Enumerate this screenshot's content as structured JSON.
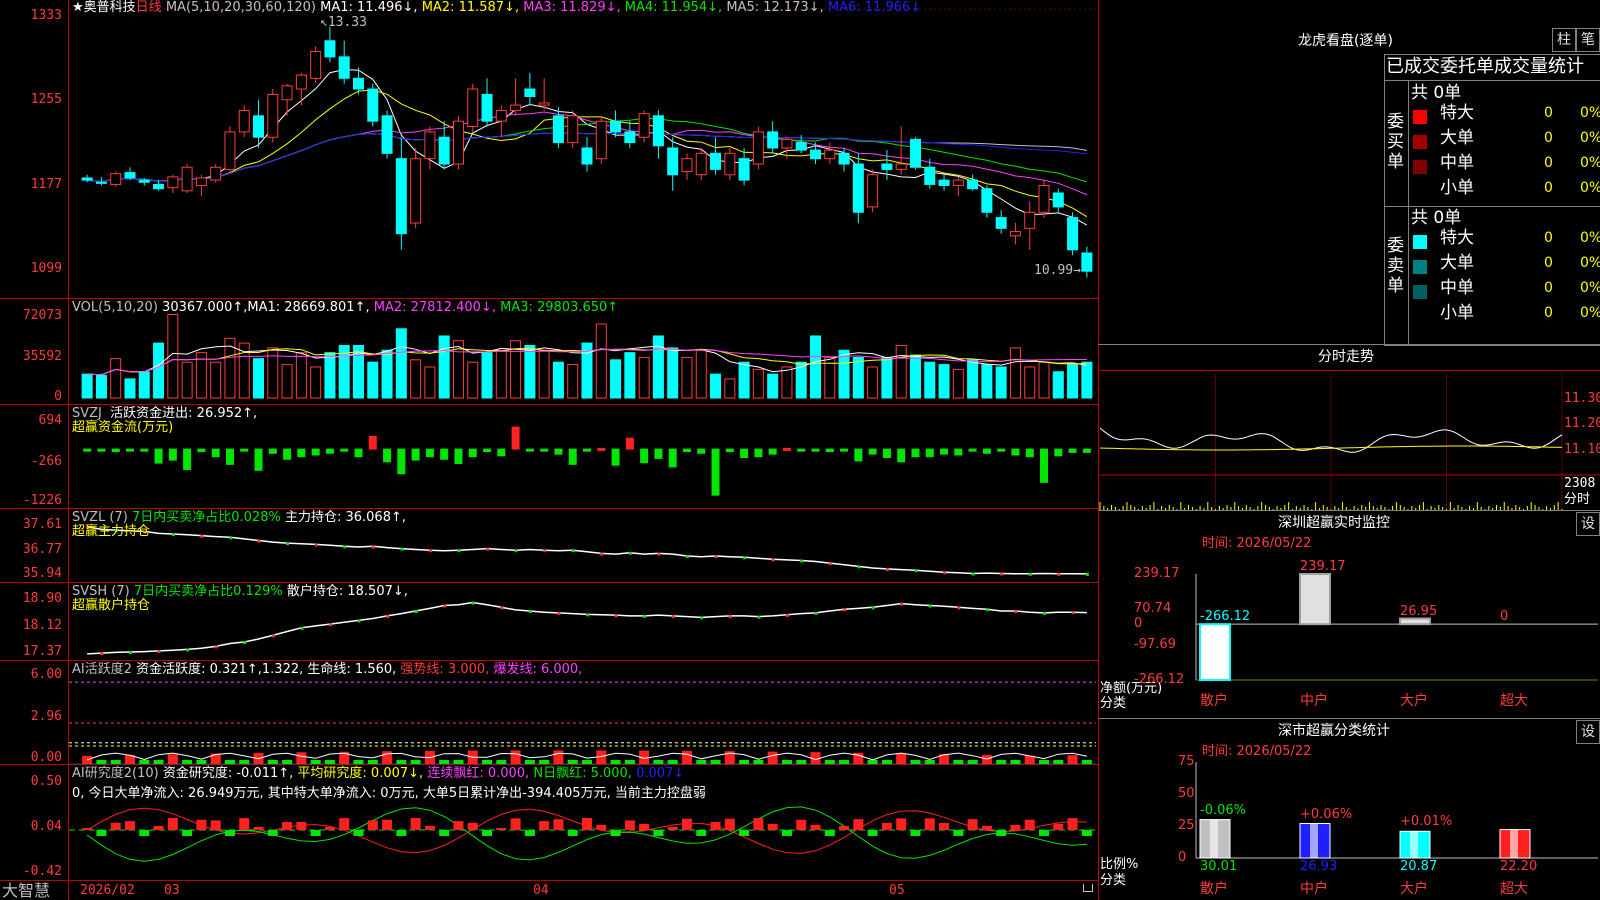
{
  "stock": {
    "star": "★",
    "name": "奥普科技",
    "period": "日线"
  },
  "main_chart": {
    "ma_header": "MA(5,10,20,30,60,120)",
    "ma1": "MA1: 11.496↓,",
    "ma2": "MA2: 11.587↓,",
    "ma3": "MA3: 11.829↓,",
    "ma4": "MA4: 11.954↓,",
    "ma5": "MA5: 12.173↓,",
    "ma6": "MA6: 11.966↓",
    "high_label": "13.33",
    "low_label": "10.99",
    "y_ticks": [
      "1333",
      "1255",
      "1177",
      "1099"
    ],
    "colors": {
      "ma1": "#ffffff",
      "ma2": "#ffff00",
      "ma3": "#ff40ff",
      "ma4": "#00e600",
      "ma5": "#c0c0c0",
      "ma6": "#2020ff",
      "up": "#ff3c3c",
      "down": "#00ffff"
    },
    "candles": [
      [
        11.92,
        11.95,
        11.88,
        11.9
      ],
      [
        11.88,
        11.93,
        11.85,
        11.87
      ],
      [
        11.86,
        11.98,
        11.84,
        11.96
      ],
      [
        11.97,
        12.02,
        11.9,
        11.92
      ],
      [
        11.9,
        11.92,
        11.85,
        11.88
      ],
      [
        11.86,
        11.9,
        11.8,
        11.82
      ],
      [
        11.83,
        11.95,
        11.78,
        11.93
      ],
      [
        11.8,
        12.05,
        11.78,
        12.02
      ],
      [
        11.85,
        11.95,
        11.75,
        11.92
      ],
      [
        11.9,
        12.05,
        11.88,
        12.02
      ],
      [
        12.0,
        12.4,
        11.98,
        12.35
      ],
      [
        12.35,
        12.6,
        12.3,
        12.55
      ],
      [
        12.5,
        12.65,
        12.2,
        12.3
      ],
      [
        12.3,
        12.75,
        12.25,
        12.7
      ],
      [
        12.65,
        12.8,
        12.5,
        12.78
      ],
      [
        12.75,
        12.9,
        12.6,
        12.88
      ],
      [
        12.85,
        13.15,
        12.8,
        13.1
      ],
      [
        13.2,
        13.33,
        13.0,
        13.05
      ],
      [
        13.05,
        13.2,
        12.8,
        12.85
      ],
      [
        12.85,
        12.95,
        12.7,
        12.75
      ],
      [
        12.75,
        12.8,
        12.4,
        12.45
      ],
      [
        12.5,
        12.55,
        12.1,
        12.15
      ],
      [
        12.1,
        12.3,
        11.25,
        11.4
      ],
      [
        11.5,
        12.2,
        11.45,
        12.1
      ],
      [
        12.1,
        12.4,
        12.0,
        12.35
      ],
      [
        12.3,
        12.45,
        12.0,
        12.05
      ],
      [
        12.05,
        12.5,
        12.0,
        12.45
      ],
      [
        12.4,
        12.8,
        12.35,
        12.75
      ],
      [
        12.7,
        12.85,
        12.4,
        12.45
      ],
      [
        12.45,
        12.6,
        12.3,
        12.55
      ],
      [
        12.55,
        12.85,
        12.5,
        12.6
      ],
      [
        12.75,
        12.9,
        12.6,
        12.68
      ],
      [
        12.6,
        12.85,
        12.55,
        12.62
      ],
      [
        12.5,
        12.58,
        12.2,
        12.25
      ],
      [
        12.25,
        12.55,
        12.2,
        12.5
      ],
      [
        12.2,
        12.3,
        11.98,
        12.05
      ],
      [
        12.1,
        12.5,
        12.05,
        12.45
      ],
      [
        12.45,
        12.55,
        12.3,
        12.35
      ],
      [
        12.35,
        12.45,
        12.2,
        12.25
      ],
      [
        12.3,
        12.55,
        12.25,
        12.52
      ],
      [
        12.5,
        12.55,
        12.1,
        12.22
      ],
      [
        12.2,
        12.3,
        11.8,
        11.95
      ],
      [
        11.98,
        12.15,
        11.9,
        12.1
      ],
      [
        11.95,
        12.2,
        11.9,
        12.15
      ],
      [
        12.15,
        12.3,
        11.95,
        12.0
      ],
      [
        11.95,
        12.2,
        11.9,
        12.15
      ],
      [
        12.1,
        12.2,
        11.85,
        11.9
      ],
      [
        12.05,
        12.4,
        12.0,
        12.35
      ],
      [
        12.35,
        12.45,
        12.15,
        12.2
      ],
      [
        12.2,
        12.3,
        12.1,
        12.28
      ],
      [
        12.25,
        12.32,
        12.15,
        12.18
      ],
      [
        12.18,
        12.25,
        12.05,
        12.1
      ],
      [
        12.1,
        12.25,
        12.05,
        12.18
      ],
      [
        12.15,
        12.2,
        11.98,
        12.05
      ],
      [
        12.05,
        12.15,
        11.5,
        11.6
      ],
      [
        11.65,
        12.0,
        11.6,
        11.95
      ],
      [
        12.05,
        12.18,
        11.9,
        12.0
      ],
      [
        12.0,
        12.4,
        11.95,
        12.05
      ],
      [
        12.28,
        12.3,
        12.0,
        12.02
      ],
      [
        12.02,
        12.1,
        11.82,
        11.86
      ],
      [
        11.9,
        11.95,
        11.8,
        11.85
      ],
      [
        11.85,
        11.93,
        11.75,
        11.9
      ],
      [
        11.9,
        11.95,
        11.8,
        11.82
      ],
      [
        11.82,
        11.85,
        11.55,
        11.6
      ],
      [
        11.55,
        11.62,
        11.4,
        11.45
      ],
      [
        11.38,
        11.5,
        11.3,
        11.42
      ],
      [
        11.45,
        11.7,
        11.25,
        11.6
      ],
      [
        11.6,
        11.9,
        11.55,
        11.85
      ],
      [
        11.78,
        11.82,
        11.6,
        11.65
      ],
      [
        11.55,
        11.6,
        11.2,
        11.25
      ],
      [
        11.22,
        11.28,
        10.99,
        11.05
      ]
    ]
  },
  "vol_panel": {
    "header": "VOL(5,10,20)",
    "value": "30367.000↑,",
    "ma1": "MA1: 28669.801↑,",
    "ma2": "MA2: 27812.400↓,",
    "ma3": "MA3: 29803.650↑",
    "y_ticks": [
      "72073",
      "35592",
      "0"
    ],
    "values": [
      20000,
      19000,
      33000,
      16000,
      22000,
      46000,
      70000,
      30000,
      38000,
      30000,
      50000,
      46000,
      33000,
      42000,
      28000,
      38000,
      26000,
      38000,
      44000,
      44000,
      30000,
      40000,
      58000,
      32000,
      26000,
      52000,
      48000,
      30000,
      38000,
      40000,
      48000,
      44000,
      40000,
      30000,
      28000,
      46000,
      62000,
      32000,
      38000,
      34000,
      52000,
      42000,
      34000,
      40000,
      20000,
      16000,
      30000,
      24000,
      20000,
      26000,
      30000,
      52000,
      34000,
      40000,
      34000,
      26000,
      34000,
      44000,
      36000,
      30000,
      28000,
      24000,
      32000,
      28000,
      26000,
      42000,
      26000,
      30000,
      22000,
      28000,
      30000
    ]
  },
  "svzj_panel": {
    "header": "SVZJ",
    "title": "活跃资金进出: 26.952↑,",
    "subtitle": "超赢资金流(万元)",
    "y_ticks": [
      "694",
      "-266",
      "-1226"
    ],
    "values": [
      -60,
      -40,
      -80,
      -30,
      -50,
      -350,
      -280,
      -500,
      -80,
      -200,
      -380,
      -60,
      -520,
      -120,
      -260,
      -200,
      -160,
      -120,
      -40,
      -200,
      320,
      -320,
      -600,
      -280,
      -200,
      -260,
      -360,
      -200,
      -80,
      -180,
      540,
      -60,
      -60,
      -140,
      -380,
      -60,
      40,
      -400,
      280,
      -340,
      -240,
      -440,
      -80,
      -120,
      -1100,
      -80,
      -220,
      -200,
      -140,
      40,
      -60,
      -40,
      -80,
      -40,
      -300,
      -140,
      -220,
      -320,
      -200,
      -200,
      -140,
      -160,
      -40,
      -120,
      -60,
      -160,
      -200,
      -800,
      -180,
      -100,
      -100
    ]
  },
  "svzl_panel": {
    "header": "SVZL (7)",
    "pct": "7日内买卖净占比0.028%",
    "label": "主力持仓: 36.068↑,",
    "subtitle": "超赢主力持仓",
    "y_ticks": [
      "37.61",
      "36.77",
      "35.94"
    ],
    "values": [
      37.52,
      37.45,
      37.42,
      37.4,
      37.38,
      37.32,
      37.3,
      37.28,
      37.25,
      37.22,
      37.2,
      37.15,
      37.1,
      37.05,
      37.02,
      37.0,
      36.98,
      36.95,
      36.92,
      36.9,
      36.92,
      36.88,
      36.85,
      36.82,
      36.8,
      36.78,
      36.8,
      36.82,
      36.85,
      36.82,
      36.8,
      36.82,
      36.8,
      36.78,
      36.8,
      36.75,
      36.7,
      36.68,
      36.72,
      36.68,
      36.7,
      36.68,
      36.62,
      36.6,
      36.62,
      36.6,
      36.58,
      36.55,
      36.52,
      36.5,
      36.48,
      36.45,
      36.4,
      36.35,
      36.3,
      36.25,
      36.22,
      36.2,
      36.18,
      36.15,
      36.12,
      36.1,
      36.08,
      36.09,
      36.08,
      36.07,
      36.07,
      36.08,
      36.07,
      36.07,
      36.068
    ]
  },
  "svsh_panel": {
    "header": "SVSH (7)",
    "pct": "7日内买卖净占比0.129%",
    "label": "散户持仓: 18.507↓,",
    "subtitle": "超赢散户持仓",
    "y_ticks": [
      "18.90",
      "18.12",
      "17.37"
    ],
    "values": [
      17.4,
      17.42,
      17.44,
      17.45,
      17.46,
      17.48,
      17.5,
      17.52,
      17.55,
      17.6,
      17.68,
      17.72,
      17.8,
      17.9,
      18.0,
      18.1,
      18.15,
      18.2,
      18.25,
      18.3,
      18.35,
      18.42,
      18.48,
      18.55,
      18.62,
      18.7,
      18.72,
      18.78,
      18.72,
      18.65,
      18.58,
      18.55,
      18.52,
      18.5,
      18.48,
      18.46,
      18.45,
      18.44,
      18.42,
      18.42,
      18.44,
      18.42,
      18.4,
      18.38,
      18.4,
      18.42,
      18.42,
      18.4,
      18.42,
      18.45,
      18.48,
      18.5,
      18.55,
      18.6,
      18.62,
      18.65,
      18.7,
      18.75,
      18.72,
      18.7,
      18.68,
      18.65,
      18.62,
      18.6,
      18.55,
      18.55,
      18.52,
      18.5,
      18.52,
      18.52,
      18.507
    ]
  },
  "ai_active": {
    "title": "AI活跃度2",
    "label": "资金活跃度: 0.321↑,",
    "v2": "1.322,",
    "life": "生命线: 1.560,",
    "strong": "强势线: 3.000,",
    "burst": "爆发线: 6.000,",
    "y_ticks": [
      "6.00",
      "2.96",
      "0.00"
    ]
  },
  "ai_research": {
    "title": "AI研究度2(10)",
    "label": "资金研究度: -0.011↑,",
    "avg": "平均研究度: 0.007↓,",
    "cont": "连续飘红: 0.000,",
    "nday": "N日飘红: 5.000,",
    "last": "0.007↓",
    "note": "0, 今日大单净流入: 26.949万元, 其中特大单净流入: 0万元, 大单5日累计净出-394.405万元, 当前主力控盘弱",
    "y_ticks": [
      "0.50",
      "0.04",
      "-0.42"
    ]
  },
  "x_axis": {
    "labels": [
      "2026/02",
      "03",
      "04",
      "05"
    ],
    "logo": "大智慧"
  },
  "longhu": {
    "title": "龙虎看盘(逐单)",
    "btn1": "柱",
    "btn2": "笔",
    "subtitle": "已成交委托单成交量统计",
    "buy_label": "委买单",
    "sell_label": "委卖单",
    "buy_total": "共 0单",
    "sell_total": "共 0单",
    "rows": [
      {
        "label": "特大",
        "val": "0",
        "pct": "0%"
      },
      {
        "label": "大单",
        "val": "0",
        "pct": "0%"
      },
      {
        "label": "中单",
        "val": "0",
        "pct": "0%"
      },
      {
        "label": "小单",
        "val": "0",
        "pct": "0%"
      }
    ],
    "sell_rows": [
      {
        "label": "特大",
        "val": "0",
        "pct": "0%"
      },
      {
        "label": "大单",
        "val": "0",
        "pct": "0%"
      },
      {
        "label": "中单",
        "val": "0",
        "pct": "0%"
      },
      {
        "label": "小单",
        "val": "0",
        "pct": "0%"
      }
    ]
  },
  "intraday": {
    "title": "分时走势",
    "y_ticks": [
      "11.30",
      "11.20",
      "11.10"
    ],
    "vol_label": "2308",
    "vol_unit": "分时"
  },
  "sz_monitor": {
    "title": "深圳超赢实时监控",
    "btn": "设",
    "time": "时间: 2026/05/22",
    "y_ticks": [
      "239.17",
      "70.74",
      "0",
      "-97.69",
      "-266.12"
    ],
    "bars": [
      {
        "label": "散户",
        "value": "-266.12"
      },
      {
        "label": "中户",
        "value": "239.17"
      },
      {
        "label": "大户",
        "value": "26.95"
      },
      {
        "label": "超大",
        "value": "0"
      }
    ],
    "ylabel": "净额(万元)",
    "xlabel": "分类"
  },
  "sz_class": {
    "title": "深市超赢分类统计",
    "btn": "设",
    "time": "时间: 2026/05/22",
    "y_ticks": [
      "75",
      "50",
      "25",
      "0"
    ],
    "bars": [
      {
        "label": "散户",
        "value": "30.01",
        "chg": "-0.06%"
      },
      {
        "label": "中户",
        "value": "26.93",
        "chg": "+0.06%"
      },
      {
        "label": "大户",
        "value": "20.87",
        "chg": "+0.01%"
      },
      {
        "label": "超大",
        "value": "22.20",
        "chg": ""
      }
    ],
    "ylabel": "比例%",
    "xlabel": "分类"
  }
}
